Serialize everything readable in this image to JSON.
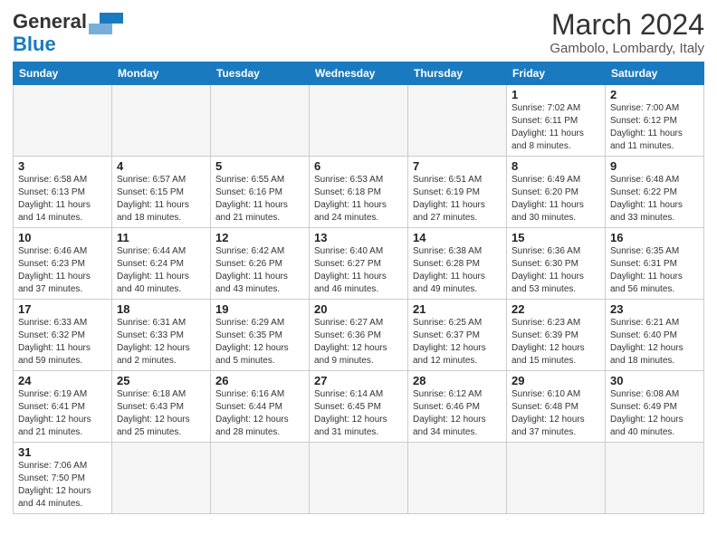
{
  "header": {
    "logo_general": "General",
    "logo_blue": "Blue",
    "month_year": "March 2024",
    "location": "Gambolo, Lombardy, Italy"
  },
  "days_of_week": [
    "Sunday",
    "Monday",
    "Tuesday",
    "Wednesday",
    "Thursday",
    "Friday",
    "Saturday"
  ],
  "weeks": [
    [
      {
        "day": "",
        "info": ""
      },
      {
        "day": "",
        "info": ""
      },
      {
        "day": "",
        "info": ""
      },
      {
        "day": "",
        "info": ""
      },
      {
        "day": "",
        "info": ""
      },
      {
        "day": "1",
        "info": "Sunrise: 7:02 AM\nSunset: 6:11 PM\nDaylight: 11 hours\nand 8 minutes."
      },
      {
        "day": "2",
        "info": "Sunrise: 7:00 AM\nSunset: 6:12 PM\nDaylight: 11 hours\nand 11 minutes."
      }
    ],
    [
      {
        "day": "3",
        "info": "Sunrise: 6:58 AM\nSunset: 6:13 PM\nDaylight: 11 hours\nand 14 minutes."
      },
      {
        "day": "4",
        "info": "Sunrise: 6:57 AM\nSunset: 6:15 PM\nDaylight: 11 hours\nand 18 minutes."
      },
      {
        "day": "5",
        "info": "Sunrise: 6:55 AM\nSunset: 6:16 PM\nDaylight: 11 hours\nand 21 minutes."
      },
      {
        "day": "6",
        "info": "Sunrise: 6:53 AM\nSunset: 6:18 PM\nDaylight: 11 hours\nand 24 minutes."
      },
      {
        "day": "7",
        "info": "Sunrise: 6:51 AM\nSunset: 6:19 PM\nDaylight: 11 hours\nand 27 minutes."
      },
      {
        "day": "8",
        "info": "Sunrise: 6:49 AM\nSunset: 6:20 PM\nDaylight: 11 hours\nand 30 minutes."
      },
      {
        "day": "9",
        "info": "Sunrise: 6:48 AM\nSunset: 6:22 PM\nDaylight: 11 hours\nand 33 minutes."
      }
    ],
    [
      {
        "day": "10",
        "info": "Sunrise: 6:46 AM\nSunset: 6:23 PM\nDaylight: 11 hours\nand 37 minutes."
      },
      {
        "day": "11",
        "info": "Sunrise: 6:44 AM\nSunset: 6:24 PM\nDaylight: 11 hours\nand 40 minutes."
      },
      {
        "day": "12",
        "info": "Sunrise: 6:42 AM\nSunset: 6:26 PM\nDaylight: 11 hours\nand 43 minutes."
      },
      {
        "day": "13",
        "info": "Sunrise: 6:40 AM\nSunset: 6:27 PM\nDaylight: 11 hours\nand 46 minutes."
      },
      {
        "day": "14",
        "info": "Sunrise: 6:38 AM\nSunset: 6:28 PM\nDaylight: 11 hours\nand 49 minutes."
      },
      {
        "day": "15",
        "info": "Sunrise: 6:36 AM\nSunset: 6:30 PM\nDaylight: 11 hours\nand 53 minutes."
      },
      {
        "day": "16",
        "info": "Sunrise: 6:35 AM\nSunset: 6:31 PM\nDaylight: 11 hours\nand 56 minutes."
      }
    ],
    [
      {
        "day": "17",
        "info": "Sunrise: 6:33 AM\nSunset: 6:32 PM\nDaylight: 11 hours\nand 59 minutes."
      },
      {
        "day": "18",
        "info": "Sunrise: 6:31 AM\nSunset: 6:33 PM\nDaylight: 12 hours\nand 2 minutes."
      },
      {
        "day": "19",
        "info": "Sunrise: 6:29 AM\nSunset: 6:35 PM\nDaylight: 12 hours\nand 5 minutes."
      },
      {
        "day": "20",
        "info": "Sunrise: 6:27 AM\nSunset: 6:36 PM\nDaylight: 12 hours\nand 9 minutes."
      },
      {
        "day": "21",
        "info": "Sunrise: 6:25 AM\nSunset: 6:37 PM\nDaylight: 12 hours\nand 12 minutes."
      },
      {
        "day": "22",
        "info": "Sunrise: 6:23 AM\nSunset: 6:39 PM\nDaylight: 12 hours\nand 15 minutes."
      },
      {
        "day": "23",
        "info": "Sunrise: 6:21 AM\nSunset: 6:40 PM\nDaylight: 12 hours\nand 18 minutes."
      }
    ],
    [
      {
        "day": "24",
        "info": "Sunrise: 6:19 AM\nSunset: 6:41 PM\nDaylight: 12 hours\nand 21 minutes."
      },
      {
        "day": "25",
        "info": "Sunrise: 6:18 AM\nSunset: 6:43 PM\nDaylight: 12 hours\nand 25 minutes."
      },
      {
        "day": "26",
        "info": "Sunrise: 6:16 AM\nSunset: 6:44 PM\nDaylight: 12 hours\nand 28 minutes."
      },
      {
        "day": "27",
        "info": "Sunrise: 6:14 AM\nSunset: 6:45 PM\nDaylight: 12 hours\nand 31 minutes."
      },
      {
        "day": "28",
        "info": "Sunrise: 6:12 AM\nSunset: 6:46 PM\nDaylight: 12 hours\nand 34 minutes."
      },
      {
        "day": "29",
        "info": "Sunrise: 6:10 AM\nSunset: 6:48 PM\nDaylight: 12 hours\nand 37 minutes."
      },
      {
        "day": "30",
        "info": "Sunrise: 6:08 AM\nSunset: 6:49 PM\nDaylight: 12 hours\nand 40 minutes."
      }
    ],
    [
      {
        "day": "31",
        "info": "Sunrise: 7:06 AM\nSunset: 7:50 PM\nDaylight: 12 hours\nand 44 minutes."
      },
      {
        "day": "",
        "info": ""
      },
      {
        "day": "",
        "info": ""
      },
      {
        "day": "",
        "info": ""
      },
      {
        "day": "",
        "info": ""
      },
      {
        "day": "",
        "info": ""
      },
      {
        "day": "",
        "info": ""
      }
    ]
  ]
}
